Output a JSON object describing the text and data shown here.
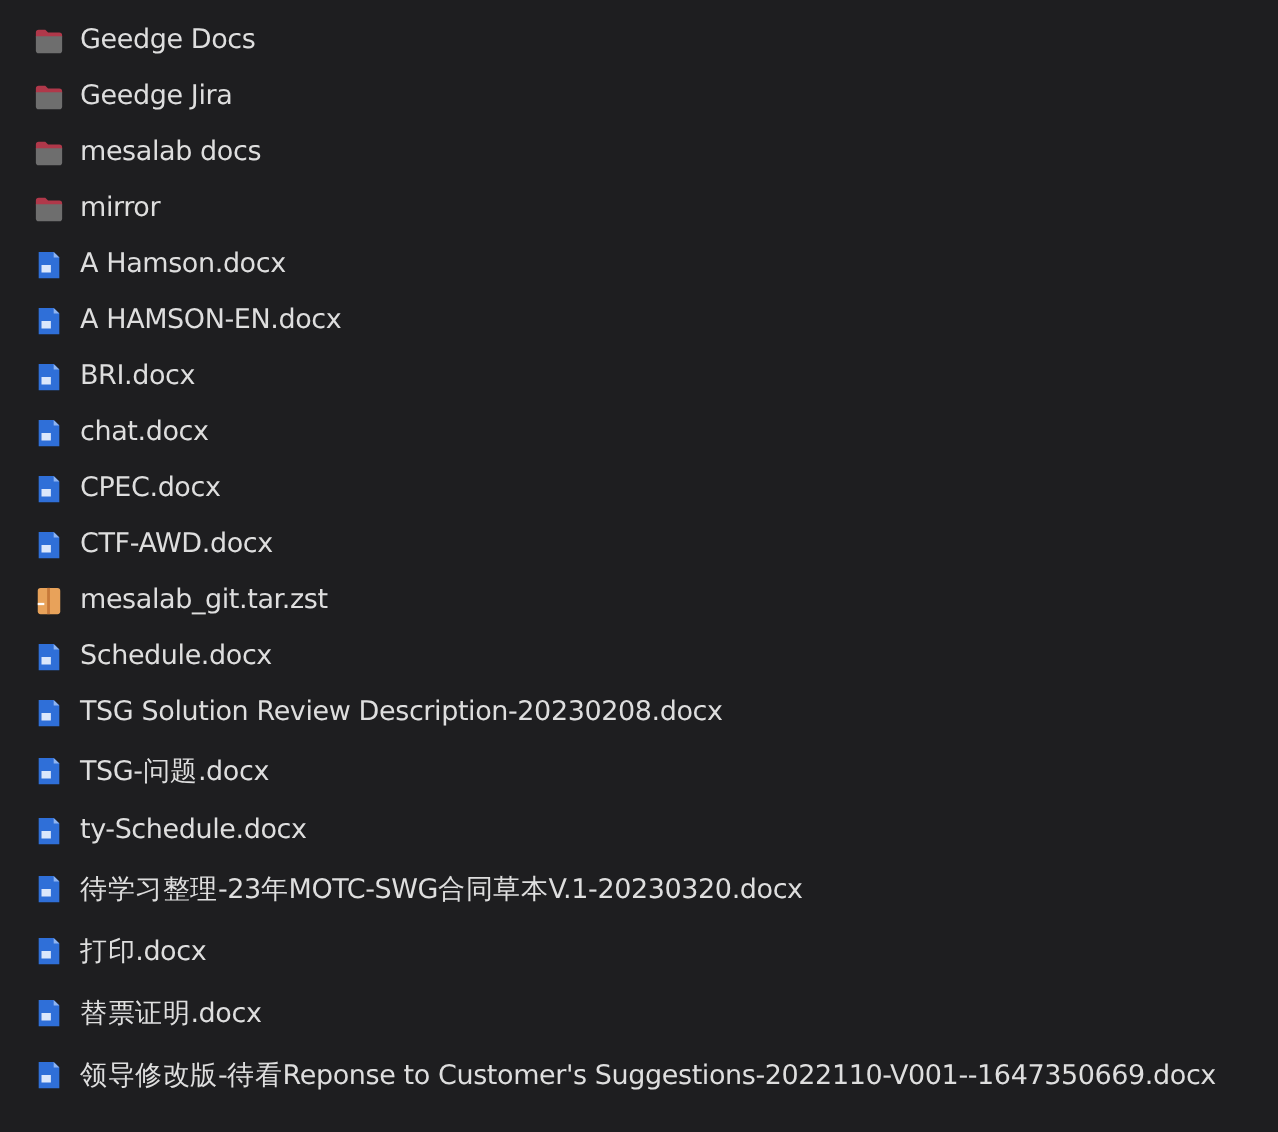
{
  "files": [
    {
      "name": "Geedge Docs",
      "kind": "folder"
    },
    {
      "name": "Geedge Jira",
      "kind": "folder"
    },
    {
      "name": "mesalab docs",
      "kind": "folder"
    },
    {
      "name": "mirror",
      "kind": "folder"
    },
    {
      "name": "A Hamson.docx",
      "kind": "docx"
    },
    {
      "name": "A HAMSON-EN.docx",
      "kind": "docx"
    },
    {
      "name": "BRI.docx",
      "kind": "docx"
    },
    {
      "name": "chat.docx",
      "kind": "docx"
    },
    {
      "name": "CPEC.docx",
      "kind": "docx"
    },
    {
      "name": "CTF-AWD.docx",
      "kind": "docx"
    },
    {
      "name": "mesalab_git.tar.zst",
      "kind": "archive"
    },
    {
      "name": "Schedule.docx",
      "kind": "docx"
    },
    {
      "name": "TSG Solution Review Description-20230208.docx",
      "kind": "docx"
    },
    {
      "name": "TSG-问题.docx",
      "kind": "docx"
    },
    {
      "name": "ty-Schedule.docx",
      "kind": "docx"
    },
    {
      "name": "待学习整理-23年MOTC-SWG合同草本V.1-20230320.docx",
      "kind": "docx"
    },
    {
      "name": "打印.docx",
      "kind": "docx"
    },
    {
      "name": "替票证明.docx",
      "kind": "docx"
    },
    {
      "name": "领导修改版-待看Reponse to Customer's Suggestions-2022110-V001--1647350669.docx",
      "kind": "docx"
    }
  ]
}
